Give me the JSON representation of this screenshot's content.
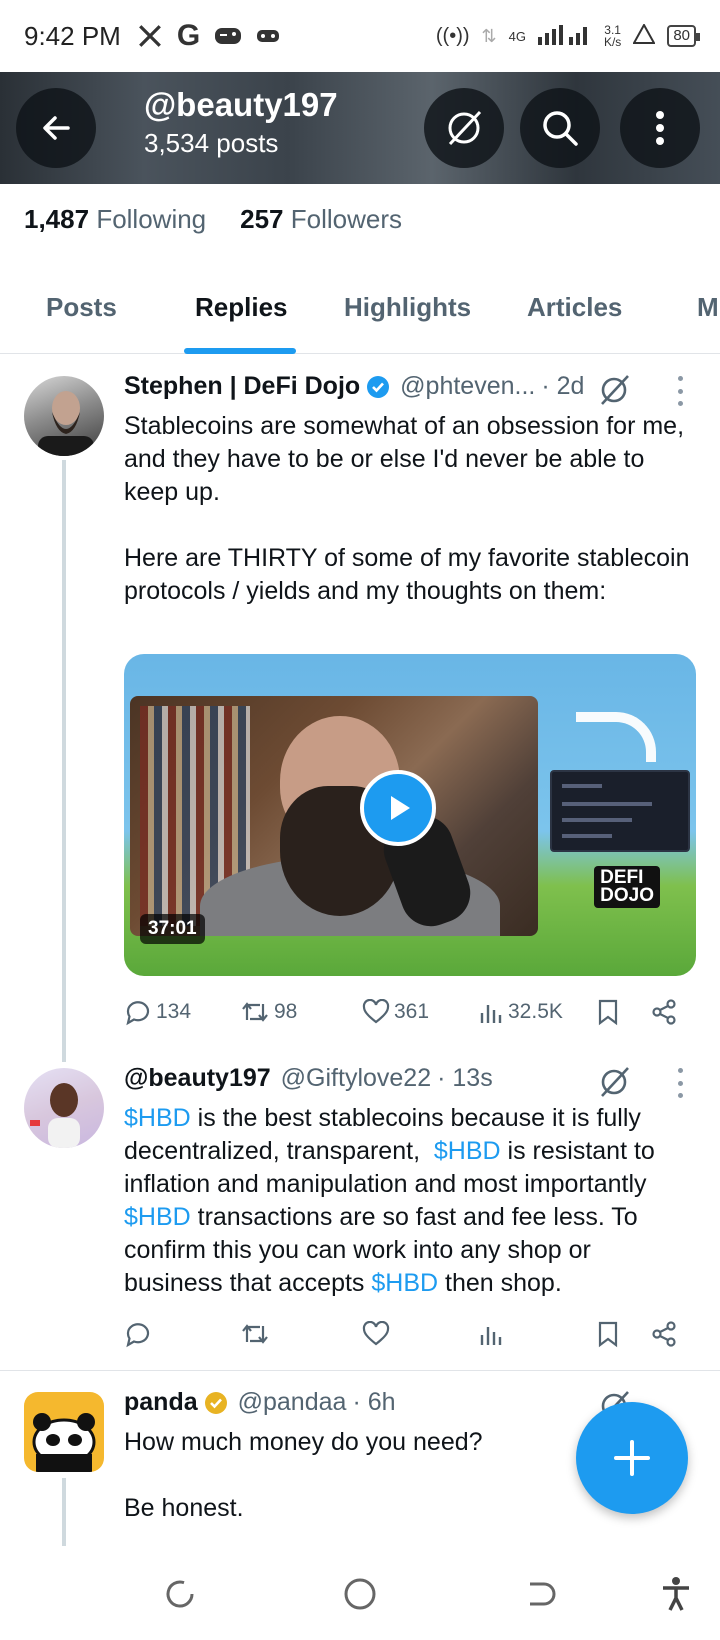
{
  "status_bar": {
    "time": "9:42 PM",
    "left_icons": [
      "x-logo-icon",
      "google-icon",
      "game-controller-icon",
      "gamepad-icon"
    ],
    "network": "4G",
    "speed_value": "3.1",
    "speed_unit": "K/s",
    "battery": "80"
  },
  "header": {
    "handle": "@beauty197",
    "posts": "3,534 posts"
  },
  "profile": {
    "following_count": "1,487",
    "following_label": "Following",
    "followers_count": "257",
    "followers_label": "Followers"
  },
  "tabs": [
    {
      "label": "Posts"
    },
    {
      "label": "Replies"
    },
    {
      "label": "Highlights"
    },
    {
      "label": "Articles"
    },
    {
      "label": "M"
    }
  ],
  "active_tab": "Replies",
  "tweets": [
    {
      "name": "Stephen | DeFi Dojo",
      "verified": "blue",
      "handle": "@phteven...",
      "time": "· 2d",
      "text": "Stablecoins are somewhat of an obsession for me, and they have to be or else I'd never be able to keep up.\n\nHere are THIRTY of some of my favorite stablecoin protocols / yields and my thoughts on them:",
      "media": {
        "duration": "37:01",
        "logo_line1": "DEFI",
        "logo_line2": "DOJO"
      },
      "stats": {
        "replies": "134",
        "reposts": "98",
        "likes": "361",
        "views": "32.5K"
      }
    },
    {
      "name": "@beauty197",
      "handle": "@Giftylove22",
      "time": "· 13s",
      "text_parts": [
        {
          "t": "$HBD",
          "tag": true
        },
        {
          "t": " is the best stablecoins because it is fully decentralized, transparent,  ",
          "tag": false
        },
        {
          "t": "$HBD",
          "tag": true
        },
        {
          "t": " is resistant to inflation and manipulation and most importantly ",
          "tag": false
        },
        {
          "t": "$HBD",
          "tag": true
        },
        {
          "t": " transactions are so fast and fee less. To confirm this you can work into any shop or business that accepts ",
          "tag": false
        },
        {
          "t": "$HBD",
          "tag": true
        },
        {
          "t": " then shop.",
          "tag": false
        }
      ]
    },
    {
      "name": "panda",
      "verified": "gold",
      "handle": "@pandaa",
      "time": "· 6h",
      "text": "How much money do you need?\n\nBe honest."
    }
  ],
  "colors": {
    "accent": "#1d9bf0",
    "text": "#0f1419",
    "secondary": "#536471",
    "gold": "#e8b323"
  }
}
